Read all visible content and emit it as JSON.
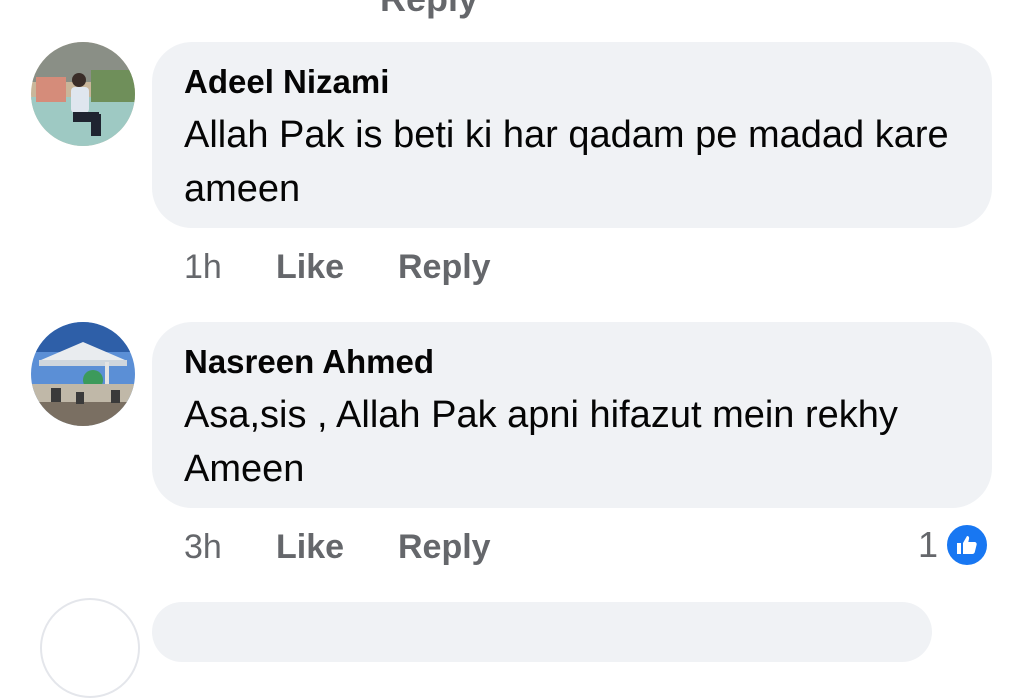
{
  "top_cut_label": "Reply",
  "comments": [
    {
      "author": "Adeel Nizami",
      "text": "Allah Pak is beti ki har qadam pe madad kare ameen",
      "time": "1h",
      "like_label": "Like",
      "reply_label": "Reply",
      "avatar_icon": "person-photo-avatar"
    },
    {
      "author": "Nasreen Ahmed",
      "text": "Asa,sis , Allah Pak apni hifazut mein rekhy Ameen",
      "time": "3h",
      "like_label": "Like",
      "reply_label": "Reply",
      "avatar_icon": "mosque-photo-avatar",
      "reaction_count": "1",
      "reaction_icon": "thumbs-up-icon"
    }
  ],
  "colors": {
    "bubble": "#f0f2f5",
    "secondary_text": "#65676b",
    "like_blue": "#1877f2"
  }
}
